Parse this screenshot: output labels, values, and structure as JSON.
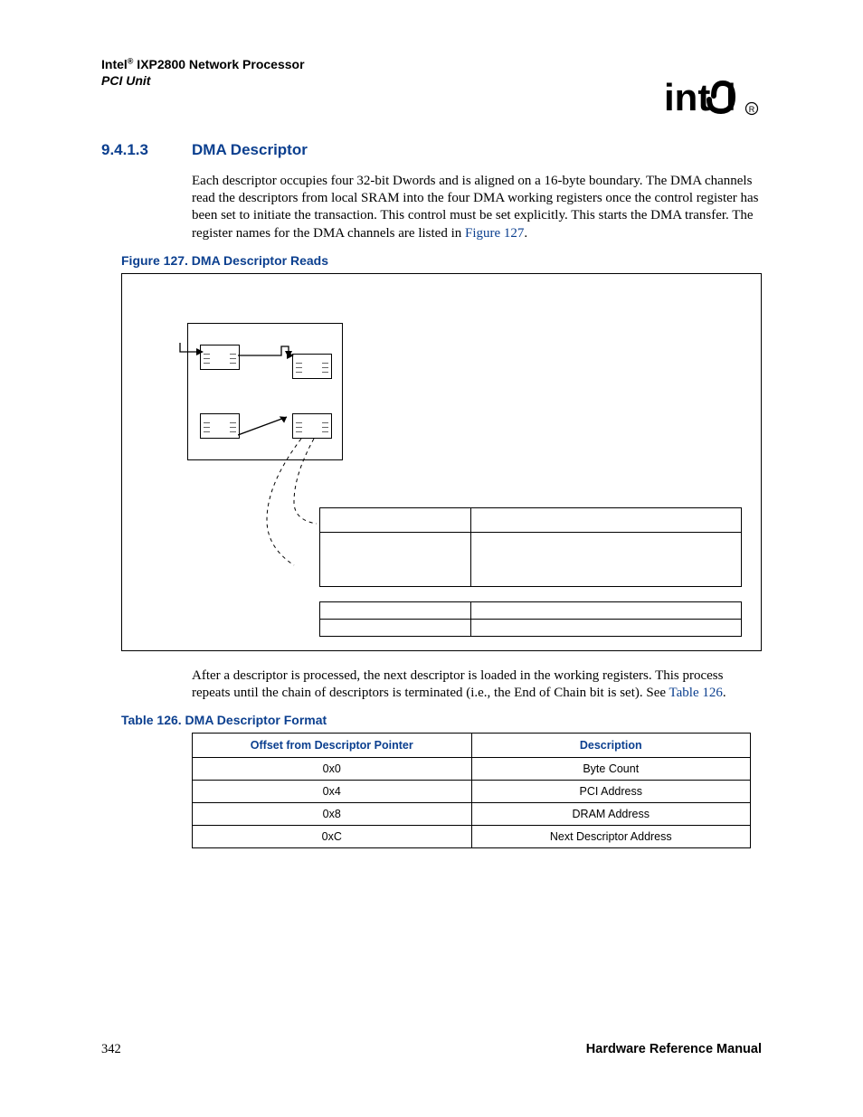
{
  "header": {
    "line1_prefix": "Intel",
    "line1_suffix": " IXP2800 Network Processor",
    "line2": "PCI Unit"
  },
  "section": {
    "number": "9.4.1.3",
    "title": "DMA Descriptor"
  },
  "para1_text": "Each descriptor occupies four 32-bit Dwords and is aligned on a 16-byte boundary. The DMA channels read the descriptors from local SRAM into the four DMA working registers once the control register has been set to initiate the transaction. This control must be set explicitly. This starts the DMA transfer. The register names for the DMA channels are listed in ",
  "para1_link": "Figure 127",
  "para1_tail": ".",
  "figure_caption": "Figure 127. DMA Descriptor Reads",
  "para2_text": "After a descriptor is processed, the next descriptor is loaded in the working registers. This process repeats until the chain of descriptors is terminated (i.e., the End of Chain bit is set). See ",
  "para2_link": "Table 126",
  "para2_tail": ".",
  "table_caption": "Table 126. DMA Descriptor Format",
  "table": {
    "headers": [
      "Offset from Descriptor Pointer",
      "Description"
    ],
    "rows": [
      [
        "0x0",
        "Byte Count"
      ],
      [
        "0x4",
        "PCI Address"
      ],
      [
        "0x8",
        "DRAM Address"
      ],
      [
        "0xC",
        "Next Descriptor Address"
      ]
    ]
  },
  "footer": {
    "page": "342",
    "manual": "Hardware Reference Manual"
  }
}
